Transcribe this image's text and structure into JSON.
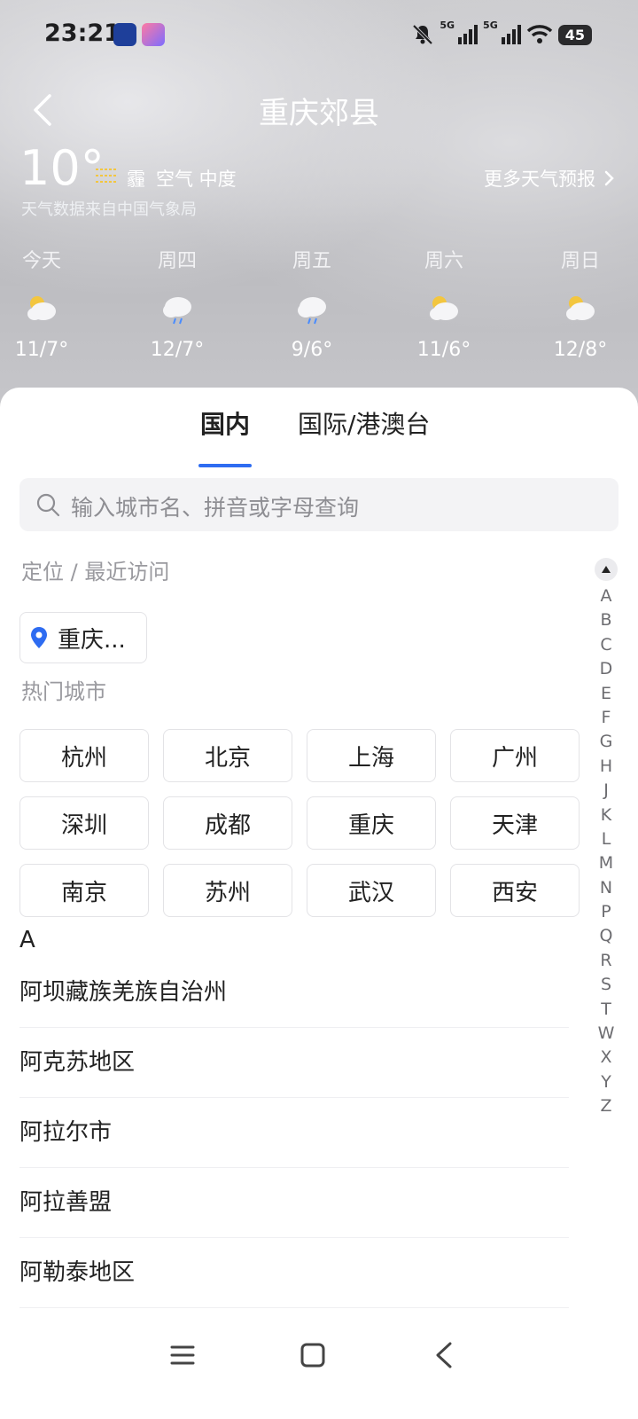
{
  "status_bar": {
    "time": "23:21",
    "signal1": "5G",
    "signal2": "5G",
    "battery": "45"
  },
  "header": {
    "title": "重庆郊县",
    "temperature": "10°",
    "condition": "霾",
    "air_quality": "空气 中度",
    "source": "天气数据来自中国气象局",
    "more_forecast": "更多天气预报"
  },
  "forecast": [
    {
      "day": "今天",
      "icon": "partly-cloudy-icon",
      "temp": "11/7°"
    },
    {
      "day": "周四",
      "icon": "cloud-rain-icon",
      "temp": "12/7°"
    },
    {
      "day": "周五",
      "icon": "cloud-rain-icon",
      "temp": "9/6°"
    },
    {
      "day": "周六",
      "icon": "partly-cloudy-icon",
      "temp": "11/6°"
    },
    {
      "day": "周日",
      "icon": "partly-cloudy-icon",
      "temp": "12/8°"
    }
  ],
  "tabs": [
    {
      "label": "国内",
      "active": true
    },
    {
      "label": "国际/港澳台",
      "active": false
    }
  ],
  "search": {
    "placeholder": "输入城市名、拼音或字母查询"
  },
  "sections": {
    "recent": "定位 / 最近访问",
    "hot": "热门城市"
  },
  "location_chip": "重庆...",
  "hot_cities": [
    "杭州",
    "北京",
    "上海",
    "广州",
    "深圳",
    "成都",
    "重庆",
    "天津",
    "南京",
    "苏州",
    "武汉",
    "西安"
  ],
  "list": {
    "letter": "A",
    "items": [
      "阿坝藏族羌族自治州",
      "阿克苏地区",
      "阿拉尔市",
      "阿拉善盟",
      "阿勒泰地区"
    ]
  },
  "index_letters": [
    "A",
    "B",
    "C",
    "D",
    "E",
    "F",
    "G",
    "H",
    "J",
    "K",
    "L",
    "M",
    "N",
    "P",
    "Q",
    "R",
    "S",
    "T",
    "W",
    "X",
    "Y",
    "Z"
  ],
  "colors": {
    "accent": "#2e6cf1",
    "location_pin": "#2e6cf1"
  }
}
